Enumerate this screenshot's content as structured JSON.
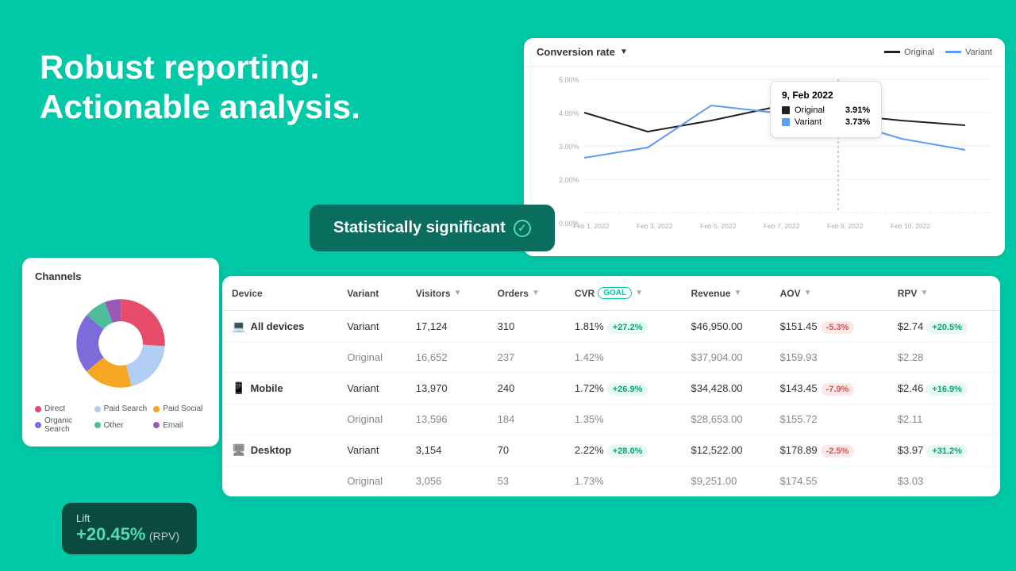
{
  "hero": {
    "line1": "Robust reporting.",
    "line2": "Actionable analysis."
  },
  "stat_sig_badge": {
    "label": "Statistically significant"
  },
  "channels": {
    "title": "Channels",
    "legend": [
      {
        "label": "Direct",
        "color": "#e84c6b"
      },
      {
        "label": "Paid Search",
        "color": "#b3cef5"
      },
      {
        "label": "Paid Social",
        "color": "#f5a623"
      },
      {
        "label": "Organic Search",
        "color": "#7c6bda"
      },
      {
        "label": "Other",
        "color": "#4dbd9a"
      },
      {
        "label": "Email",
        "color": "#9b59b6"
      }
    ],
    "donut_segments": [
      {
        "pct": 0.26,
        "color": "#e84c6b"
      },
      {
        "pct": 0.2,
        "color": "#b3cef5"
      },
      {
        "pct": 0.18,
        "color": "#f5a623"
      },
      {
        "pct": 0.22,
        "color": "#7c6bda"
      },
      {
        "pct": 0.08,
        "color": "#4dbd9a"
      },
      {
        "pct": 0.06,
        "color": "#9b59b6"
      }
    ]
  },
  "lift": {
    "label": "Lift",
    "value": "+20.45%",
    "unit": "(RPV)"
  },
  "chart": {
    "title": "Conversion rate",
    "legend": [
      {
        "label": "Original",
        "color": "#222"
      },
      {
        "label": "Variant",
        "color": "#5b9cf6"
      }
    ],
    "tooltip": {
      "date": "9, Feb 2022",
      "rows": [
        {
          "label": "Original",
          "value": "3.91%",
          "color": "#222"
        },
        {
          "label": "Variant",
          "value": "3.73%",
          "color": "#5b9cf6"
        }
      ]
    },
    "x_labels": [
      "Feb 1, 2022",
      "Feb 3, 2022",
      "Feb 5, 2022",
      "Feb 7, 2022",
      "Feb 9, 2022",
      "Feb 10, 2022"
    ],
    "y_labels": [
      "5.00%",
      "4.00%",
      "3.00%",
      "2.00%",
      "0.00%"
    ]
  },
  "table": {
    "headers": [
      {
        "label": "Device",
        "has_arrow": false
      },
      {
        "label": "Variant",
        "has_arrow": false
      },
      {
        "label": "Visitors",
        "has_arrow": true
      },
      {
        "label": "Orders",
        "has_arrow": true
      },
      {
        "label": "CVR",
        "has_arrow": true,
        "has_goal": true
      },
      {
        "label": "Revenue",
        "has_arrow": true
      },
      {
        "label": "AOV",
        "has_arrow": true
      },
      {
        "label": "RPV",
        "has_arrow": true
      }
    ],
    "rows": [
      {
        "device": "All devices",
        "device_icon": "💻",
        "variant": "Variant",
        "visitors": "17,124",
        "orders": "310",
        "cvr": "1.81%",
        "cvr_badge": "+27.2%",
        "cvr_badge_type": "green",
        "revenue": "$46,950.00",
        "aov": "$151.45",
        "aov_badge": "-5.3%",
        "aov_badge_type": "red",
        "rpv": "$2.74",
        "rpv_badge": "+20.5%",
        "rpv_badge_type": "green",
        "is_main": true
      },
      {
        "device": "",
        "variant": "Original",
        "visitors": "16,652",
        "orders": "237",
        "cvr": "1.42%",
        "revenue": "$37,904.00",
        "aov": "$159.93",
        "rpv": "$2.28",
        "is_main": false
      },
      {
        "device": "Mobile",
        "device_icon": "📱",
        "variant": "Variant",
        "visitors": "13,970",
        "orders": "240",
        "cvr": "1.72%",
        "cvr_badge": "+26.9%",
        "cvr_badge_type": "green",
        "revenue": "$34,428.00",
        "aov": "$143.45",
        "aov_badge": "-7.9%",
        "aov_badge_type": "red",
        "rpv": "$2.46",
        "rpv_badge": "+16.9%",
        "rpv_badge_type": "green",
        "is_main": true
      },
      {
        "device": "",
        "variant": "Original",
        "visitors": "13,596",
        "orders": "184",
        "cvr": "1.35%",
        "revenue": "$28,653.00",
        "aov": "$155.72",
        "rpv": "$2.11",
        "is_main": false
      },
      {
        "device": "Desktop",
        "device_icon": "🖥",
        "variant": "Variant",
        "visitors": "3,154",
        "orders": "70",
        "cvr": "2.22%",
        "cvr_badge": "+28.0%",
        "cvr_badge_type": "green",
        "revenue": "$12,522.00",
        "aov": "$178.89",
        "aov_badge": "-2.5%",
        "aov_badge_type": "red",
        "rpv": "$3.97",
        "rpv_badge": "+31.2%",
        "rpv_badge_type": "green",
        "is_main": true
      },
      {
        "device": "",
        "variant": "Original",
        "visitors": "3,056",
        "orders": "53",
        "cvr": "1.73%",
        "revenue": "$9,251.00",
        "aov": "$174.55",
        "rpv": "$3.03",
        "is_main": false
      }
    ]
  }
}
